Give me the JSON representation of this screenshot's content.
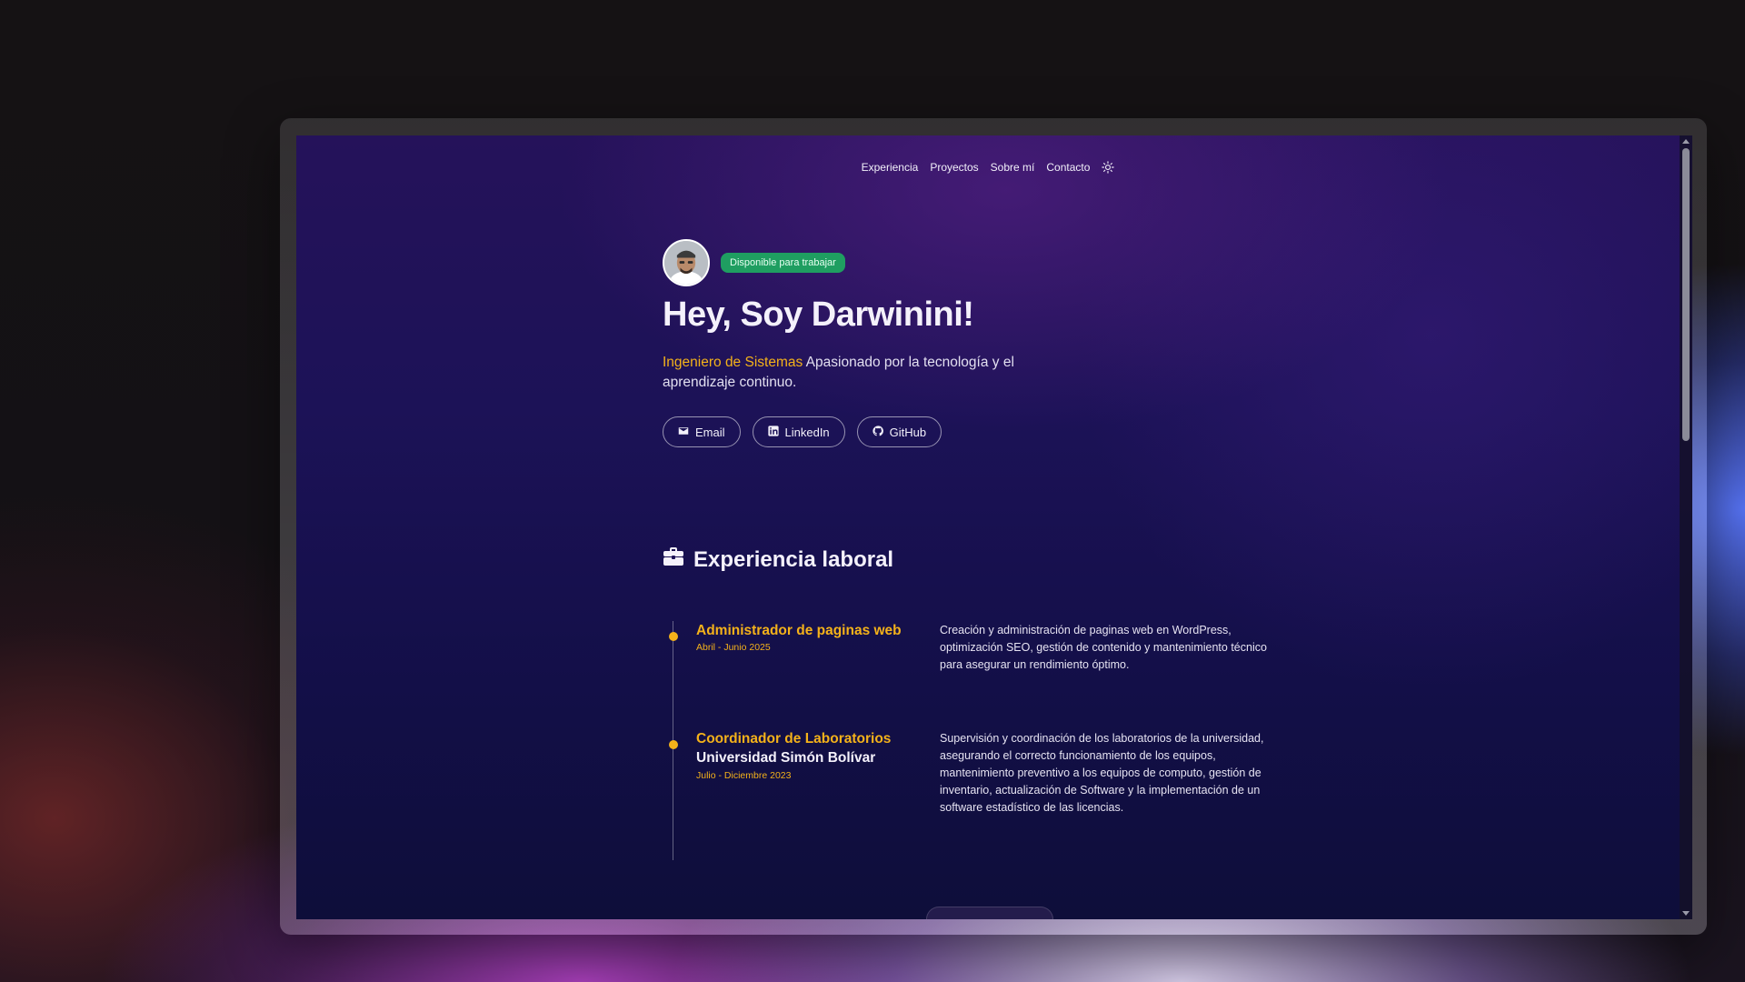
{
  "nav": {
    "items": [
      "Experiencia",
      "Proyectos",
      "Sobre mí",
      "Contacto"
    ],
    "theme_toggle_icon": "sun-icon"
  },
  "hero": {
    "badge": "Disponible para trabajar",
    "title": "Hey, Soy Darwinini!",
    "subtitle_accent": "Ingeniero de Sistemas",
    "subtitle_rest": " Apasionado por la tecnología y el aprendizaje continuo.",
    "links": [
      {
        "label": "Email",
        "icon": "mail-icon"
      },
      {
        "label": "LinkedIn",
        "icon": "linkedin-icon"
      },
      {
        "label": "GitHub",
        "icon": "github-icon"
      }
    ]
  },
  "experience": {
    "title": "Experiencia laboral",
    "icon": "briefcase-icon",
    "items": [
      {
        "role": "Administrador de paginas web",
        "company": "",
        "dates": "Abril - Junio 2025",
        "description": "Creación y administración de paginas web en WordPress, optimización SEO, gestión de contenido y mantenimiento técnico para asegurar un rendimiento óptimo."
      },
      {
        "role": "Coordinador de Laboratorios",
        "company": "Universidad Simón Bolívar",
        "dates": "Julio - Diciembre 2023",
        "description": "Supervisión y coordinación de los laboratorios de la universidad, asegurando el correcto funcionamiento de los equipos, mantenimiento preventivo a los equipos de computo, gestión de inventario, actualización de Software y la implementación de un software estadístico de las licencias."
      }
    ]
  },
  "colors": {
    "accent": "#f4b21a",
    "badge_bg": "#1f9e61",
    "background": "#1c1257"
  }
}
